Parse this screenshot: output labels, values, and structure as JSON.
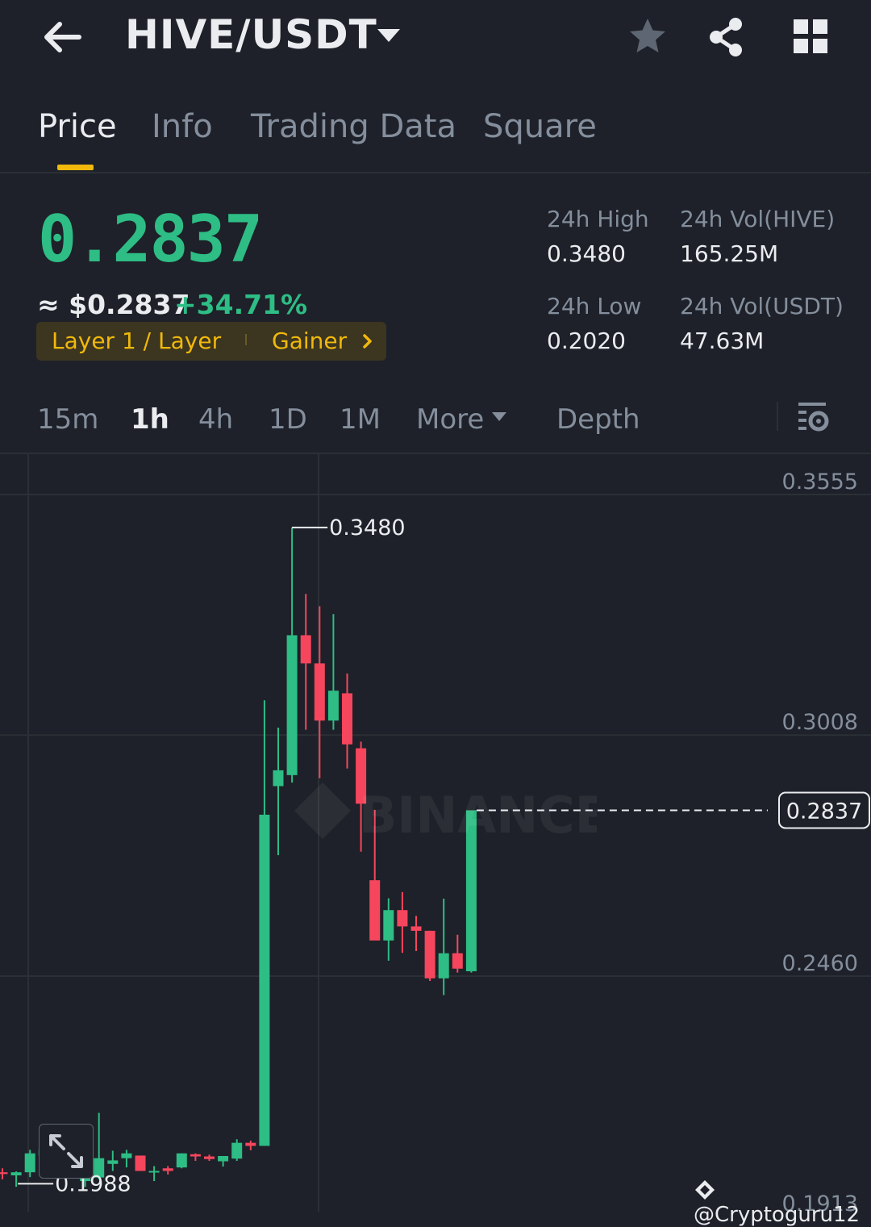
{
  "header": {
    "pair": "HIVE/USDT",
    "icons": [
      "back-arrow-icon",
      "chevron-down-icon",
      "star-icon",
      "share-icon",
      "grid-icon"
    ]
  },
  "tabs": [
    {
      "label": "Price",
      "active": true
    },
    {
      "label": "Info",
      "active": false
    },
    {
      "label": "Trading Data",
      "active": false
    },
    {
      "label": "Square",
      "active": false
    }
  ],
  "ticker": {
    "last_price": "0.2837",
    "usd_price": "≈ $0.2837",
    "change_pct": "+34.71%",
    "tags": {
      "category": "Layer 1 / Layer",
      "label": "Gainer"
    },
    "stats": {
      "high_label": "24h High",
      "high_value": "0.3480",
      "low_label": "24h Low",
      "low_value": "0.2020",
      "vol_base_label": "24h Vol(HIVE)",
      "vol_base_value": "165.25M",
      "vol_quote_label": "24h Vol(USDT)",
      "vol_quote_value": "47.63M"
    }
  },
  "intervals": {
    "items": [
      "15m",
      "1h",
      "4h",
      "1D",
      "1M",
      "More"
    ],
    "active": "1h",
    "depth": "Depth"
  },
  "colors": {
    "up": "#2ebd85",
    "down": "#f6465d",
    "accent": "#f0b90b",
    "background": "#1e2129"
  },
  "chart_data": {
    "type": "candlestick",
    "y_ticks": [
      "0.3555",
      "0.3008",
      "0.2460",
      "0.1913"
    ],
    "ylim": [
      0.1913,
      0.3555
    ],
    "grid": true,
    "last_price_label": "0.2837",
    "high_marker": "0.3480",
    "low_marker": "0.1988",
    "watermark": "BINANCE",
    "candles": [
      {
        "o": 0.2014,
        "h": 0.2023,
        "l": 0.1998,
        "c": 0.201
      },
      {
        "o": 0.2007,
        "h": 0.2016,
        "l": 0.1981,
        "c": 0.2014
      },
      {
        "o": 0.2014,
        "h": 0.2065,
        "l": 0.2003,
        "c": 0.2057
      },
      {
        "o": 0.2052,
        "h": 0.2083,
        "l": 0.204,
        "c": 0.2065
      },
      {
        "o": 0.2068,
        "h": 0.2081,
        "l": 0.2054,
        "c": 0.2075
      },
      {
        "o": 0.2077,
        "h": 0.2085,
        "l": 0.205,
        "c": 0.2046
      },
      {
        "o": 0.1994,
        "h": 0.2009,
        "l": 0.1981,
        "c": 0.2002
      },
      {
        "o": 0.2002,
        "h": 0.2149,
        "l": 0.1998,
        "c": 0.2046
      },
      {
        "o": 0.2033,
        "h": 0.2063,
        "l": 0.2017,
        "c": 0.2041
      },
      {
        "o": 0.2046,
        "h": 0.2065,
        "l": 0.2025,
        "c": 0.2057
      },
      {
        "o": 0.2052,
        "h": 0.2052,
        "l": 0.2017,
        "c": 0.2017
      },
      {
        "o": 0.2017,
        "h": 0.2028,
        "l": 0.1994,
        "c": 0.2017
      },
      {
        "o": 0.2023,
        "h": 0.2028,
        "l": 0.2009,
        "c": 0.2017
      },
      {
        "o": 0.2025,
        "h": 0.2057,
        "l": 0.2023,
        "c": 0.2057
      },
      {
        "o": 0.2055,
        "h": 0.2057,
        "l": 0.204,
        "c": 0.205
      },
      {
        "o": 0.205,
        "h": 0.2054,
        "l": 0.204,
        "c": 0.2044
      },
      {
        "o": 0.2039,
        "h": 0.2051,
        "l": 0.2027,
        "c": 0.2051
      },
      {
        "o": 0.2045,
        "h": 0.2089,
        "l": 0.204,
        "c": 0.2081
      },
      {
        "o": 0.2081,
        "h": 0.2086,
        "l": 0.2064,
        "c": 0.2074
      },
      {
        "o": 0.2074,
        "h": 0.3087,
        "l": 0.2074,
        "c": 0.2827
      },
      {
        "o": 0.2892,
        "h": 0.3025,
        "l": 0.2735,
        "c": 0.2928
      },
      {
        "o": 0.2917,
        "h": 0.348,
        "l": 0.29,
        "c": 0.3235
      },
      {
        "o": 0.3235,
        "h": 0.3329,
        "l": 0.302,
        "c": 0.3171
      },
      {
        "o": 0.3171,
        "h": 0.3301,
        "l": 0.291,
        "c": 0.3041
      },
      {
        "o": 0.3041,
        "h": 0.3283,
        "l": 0.302,
        "c": 0.3109
      },
      {
        "o": 0.3103,
        "h": 0.3148,
        "l": 0.2932,
        "c": 0.2987
      },
      {
        "o": 0.2978,
        "h": 0.2993,
        "l": 0.2743,
        "c": 0.2852
      },
      {
        "o": 0.2678,
        "h": 0.2838,
        "l": 0.2579,
        "c": 0.2541
      },
      {
        "o": 0.2541,
        "h": 0.2637,
        "l": 0.2495,
        "c": 0.261
      },
      {
        "o": 0.261,
        "h": 0.2651,
        "l": 0.2513,
        "c": 0.2573
      },
      {
        "o": 0.2573,
        "h": 0.2597,
        "l": 0.2517,
        "c": 0.2563
      },
      {
        "o": 0.2563,
        "h": 0.2563,
        "l": 0.2449,
        "c": 0.2455
      },
      {
        "o": 0.2455,
        "h": 0.2636,
        "l": 0.2417,
        "c": 0.2512
      },
      {
        "o": 0.2512,
        "h": 0.2554,
        "l": 0.2468,
        "c": 0.2477
      },
      {
        "o": 0.2471,
        "h": 0.2837,
        "l": 0.2468,
        "c": 0.2837
      }
    ]
  },
  "credit": "@Cryptoguru12"
}
